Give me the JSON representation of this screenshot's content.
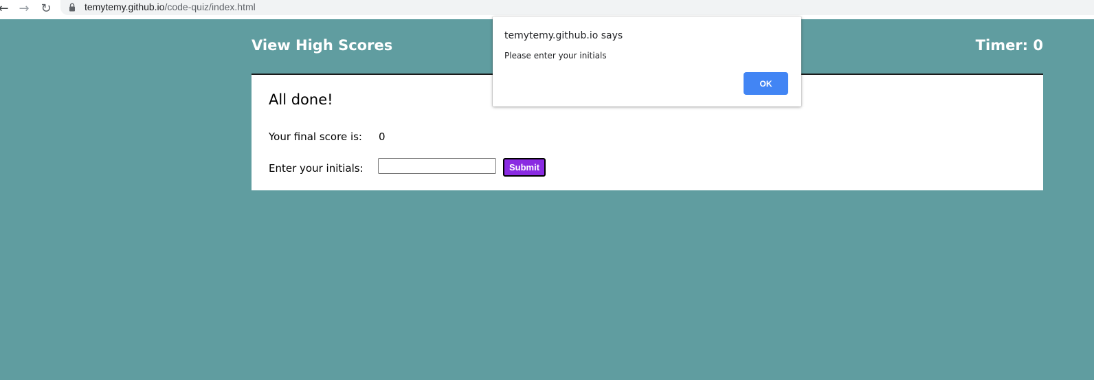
{
  "browser": {
    "back_icon": "←",
    "forward_icon": "→",
    "reload_icon": "↻",
    "url_host": "temytemy.github.io",
    "url_path": "/code-quiz/index.html"
  },
  "header": {
    "high_scores_label": "View High Scores",
    "timer_label": "Timer: 0"
  },
  "quiz_end": {
    "title": "All done!",
    "score_label": "Your final score is:",
    "score_value": "0",
    "initials_label": "Enter your initials:",
    "initials_value": "",
    "submit_label": "Submit"
  },
  "dialog": {
    "title": "temytemy.github.io says",
    "message": "Please enter your initials",
    "ok_label": "OK"
  },
  "colors": {
    "page_background": "#609da0",
    "submit_background": "#8a2be2",
    "dialog_ok_background": "#4285f4"
  }
}
